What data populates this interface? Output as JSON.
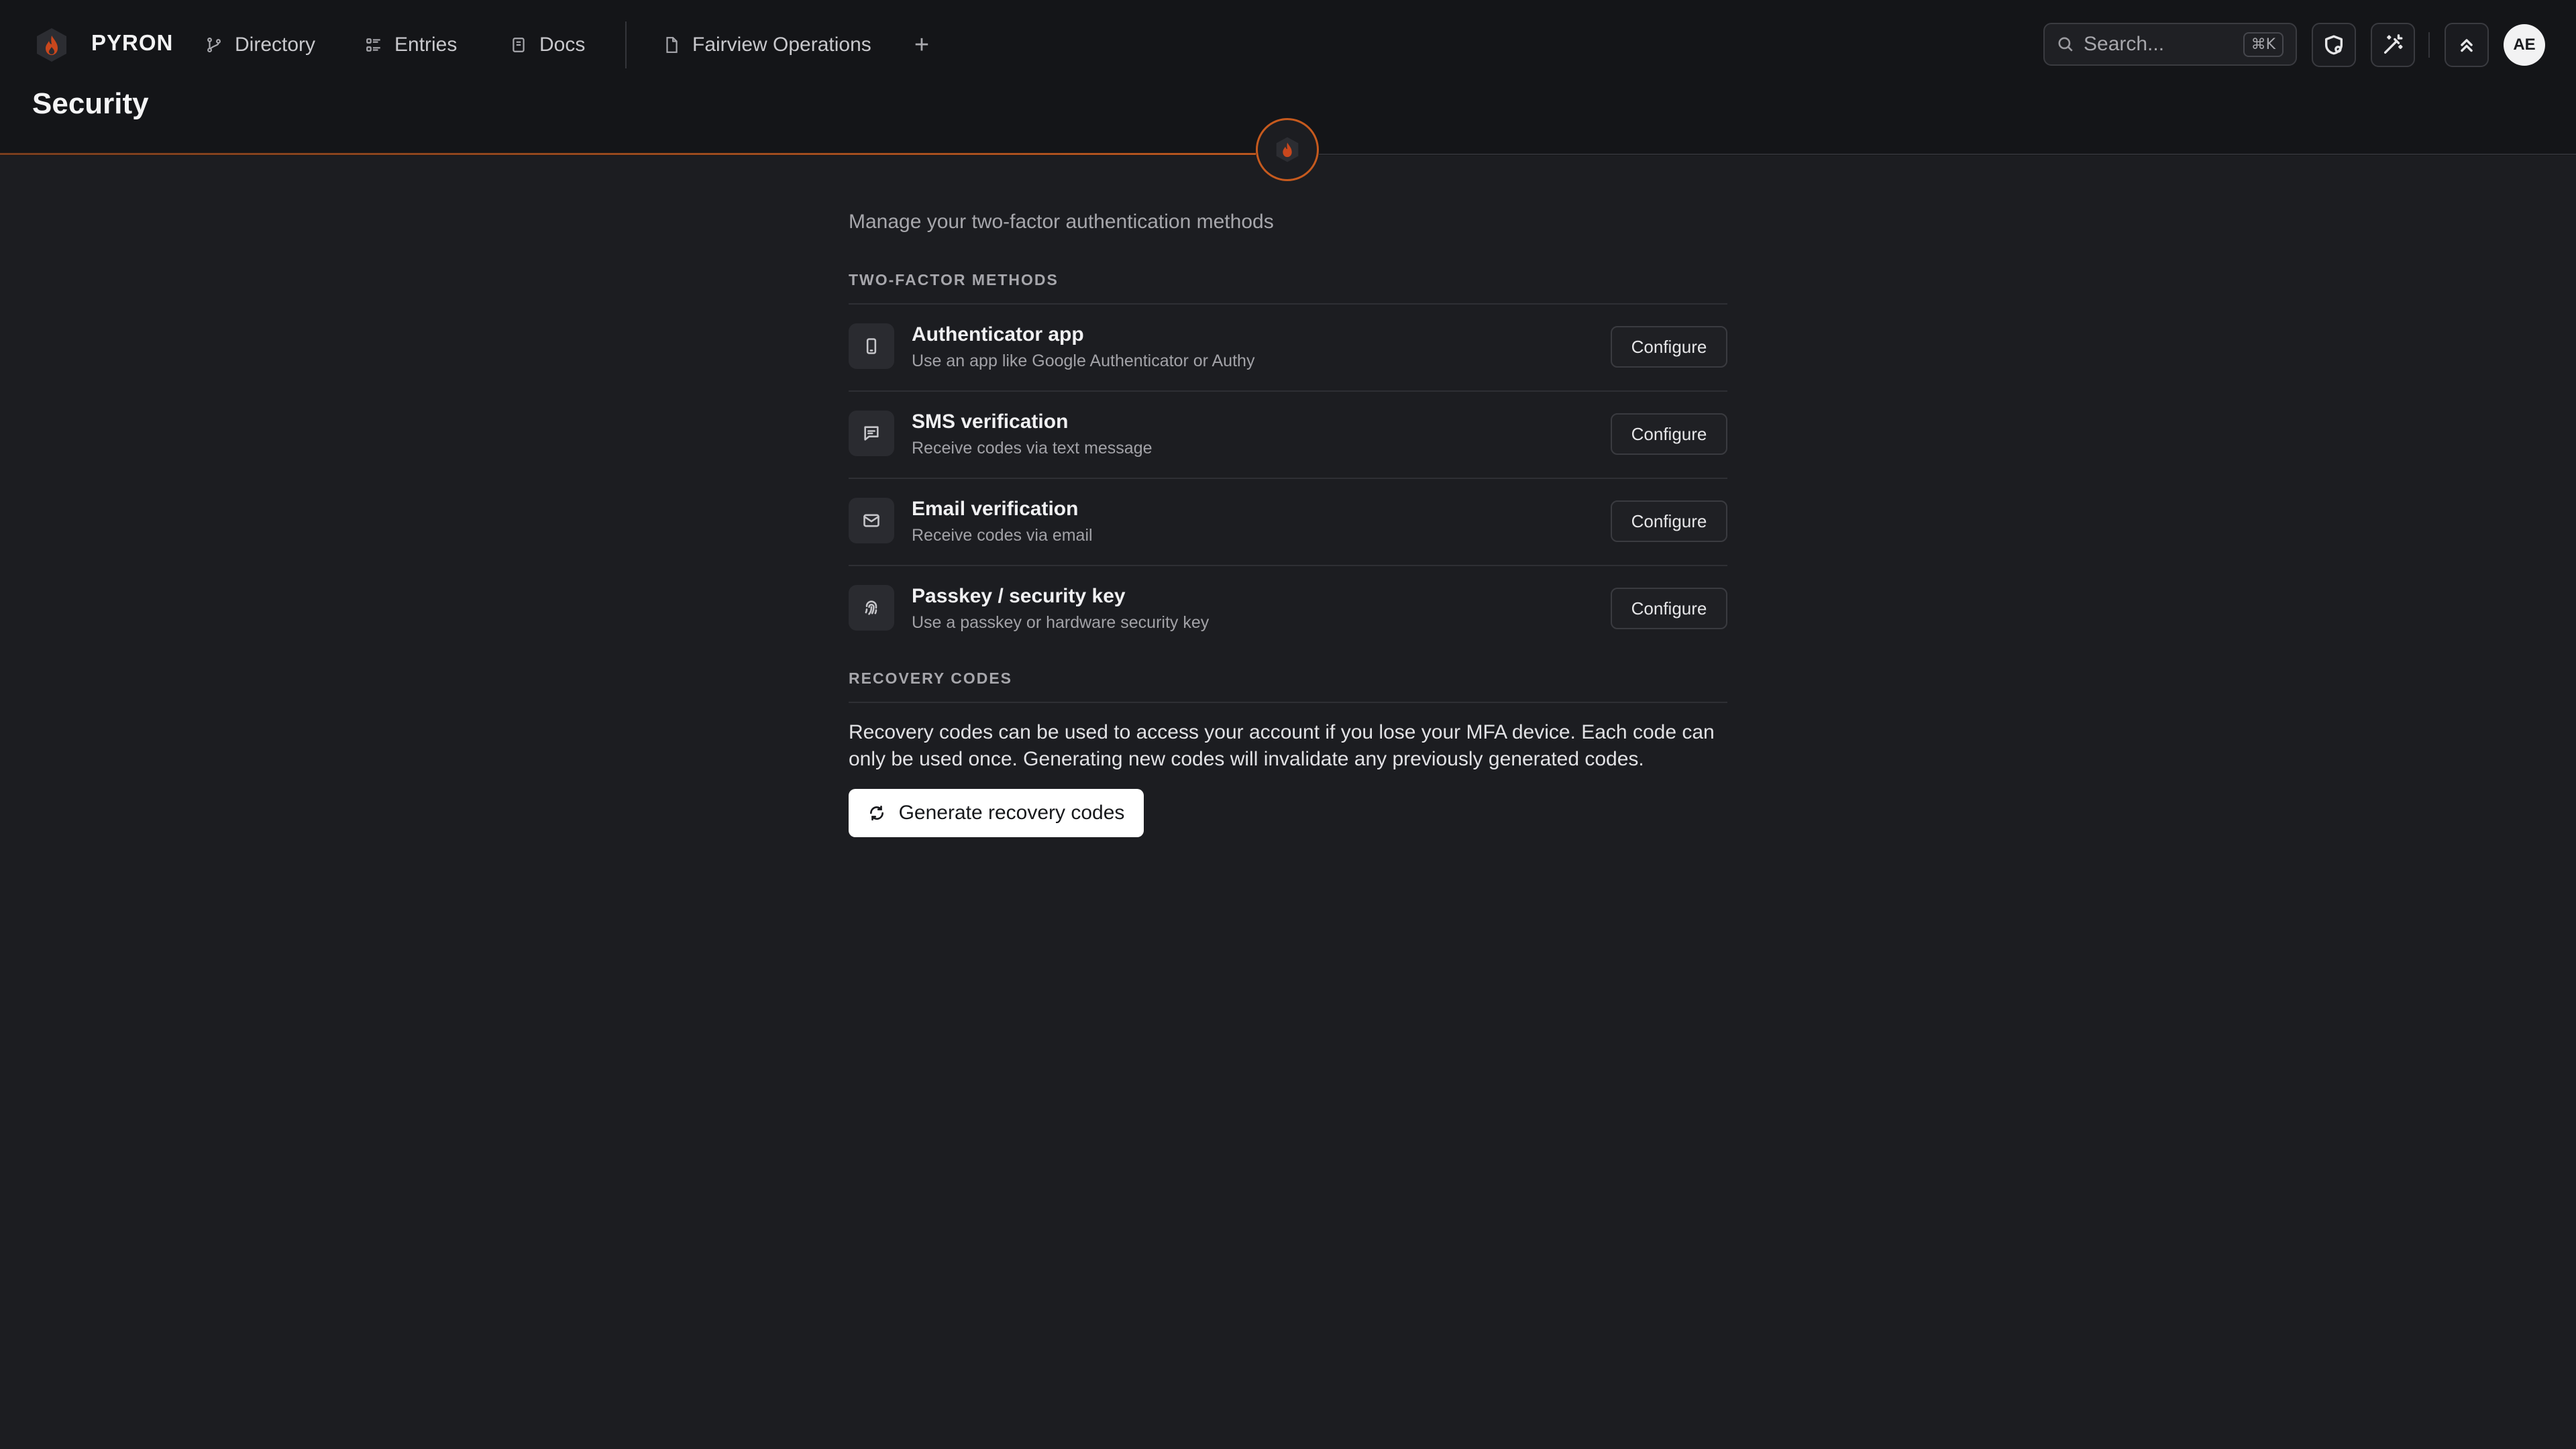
{
  "app": {
    "brand": "PYRON",
    "accent_color": "#c65a1e",
    "logo_icon": "flame-logo-icon"
  },
  "nav": {
    "items": [
      {
        "label": "Directory",
        "icon": "directory-icon"
      },
      {
        "label": "Entries",
        "icon": "entries-icon"
      },
      {
        "label": "Docs",
        "icon": "docs-icon"
      }
    ],
    "open_tab": {
      "label": "Fairview Operations",
      "icon": "file-icon"
    },
    "add_tab_icon": "plus-icon"
  },
  "search": {
    "placeholder": "Search...",
    "shortcut": "⌘K"
  },
  "toolbar": {
    "icons": [
      "shield-settings-icon",
      "magic-wand-icon",
      "chevrons-up-icon"
    ]
  },
  "user": {
    "initials": "AE"
  },
  "page": {
    "title": "Security",
    "subtitle": "Manage your two-factor authentication methods"
  },
  "two_factor": {
    "section_label": "TWO-FACTOR METHODS",
    "methods": [
      {
        "title": "Authenticator app",
        "description": "Use an app like Google Authenticator or Authy",
        "action": "Configure",
        "icon": "smartphone-icon"
      },
      {
        "title": "SMS verification",
        "description": "Receive codes via text message",
        "action": "Configure",
        "icon": "message-icon"
      },
      {
        "title": "Email verification",
        "description": "Receive codes via email",
        "action": "Configure",
        "icon": "mail-icon"
      },
      {
        "title": "Passkey / security key",
        "description": "Use a passkey or hardware security key",
        "action": "Configure",
        "icon": "fingerprint-icon"
      }
    ]
  },
  "recovery": {
    "section_label": "RECOVERY CODES",
    "text": "Recovery codes can be used to access your account if you lose your MFA device. Each code can only be used once. Generating new codes will invalidate any previously generated codes.",
    "button_label": "Generate recovery codes",
    "button_icon": "refresh-icon"
  }
}
